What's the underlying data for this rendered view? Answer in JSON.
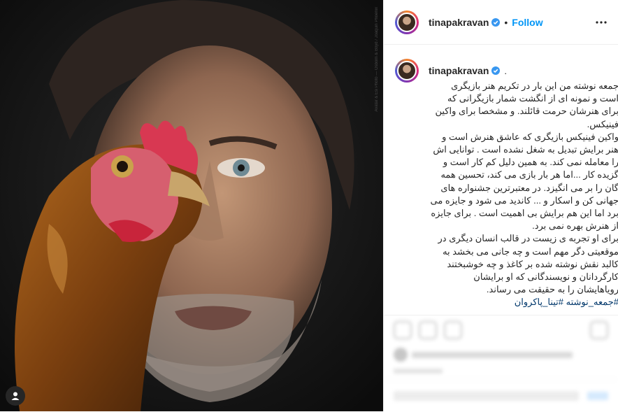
{
  "post": {
    "username": "tinapakravan",
    "follow_label": "Follow",
    "separator": "•",
    "caption_tail": ".",
    "caption_paragraphs": [
      "جمعه نوشته من این بار در تکریم هنر بازیگری است و نمونه ای از انگشت شمار بازیگرانی که برای هنرشان حرمت قائلند. و مشخصا برای واکین فینیکس.",
      "واکین فینیکس بازیگری که عاشق هنرش است و هنر برایش تبدیل به شغل نشده است . توانایی اش را معامله نمی کند. به همین دلیل کم کار است و گزیده کار ...اما هر بار بازی می کند، تحسین همه گان را بر می انگیزد. در معتبرترین جشنواره های جهانی کن و اسکار و ... کاندید می شود و جایزه می برد اما این هم برایش بی اهمیت است . برای جایزه از هنرش بهره نمی برد.",
      "برای او تجربه ی زیست در قالب انسان دیگری در موقعیتی دگر مهم است و چه جانی می بخشد به کالبد نقش نوشته شده بر کاغذ و چه خوشبختند کارگردانان و نویسندگانی که او برایشان رویاهایشان را به حقیقت می رساند."
    ],
    "hashtags": "#جمعه_نوشته #تینا_پاکروان"
  },
  "photo": {
    "credit": "Avatar & Esi Photo — Osborn & Boyd / Joaquin Phoenix"
  },
  "colors": {
    "link_blue": "#0095f6",
    "hashtag_blue": "#00376b",
    "text": "#262626"
  },
  "icons": {
    "verified": "verified-badge-icon",
    "more": "more-options-icon",
    "tag": "user-tag-icon"
  }
}
